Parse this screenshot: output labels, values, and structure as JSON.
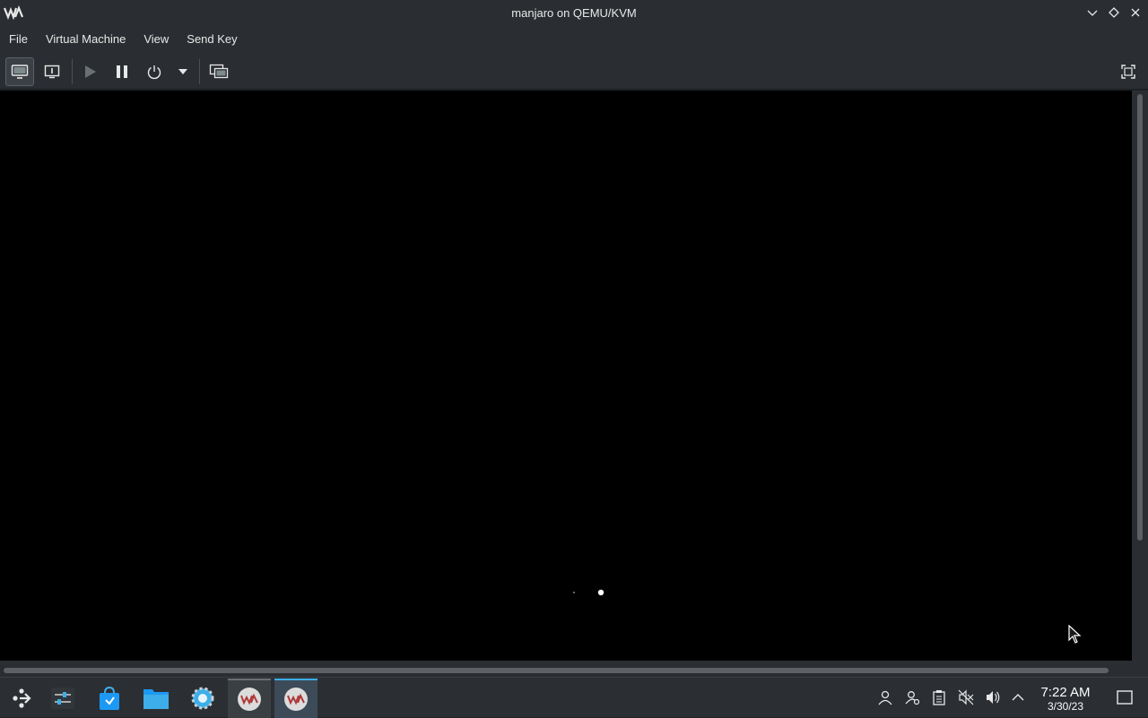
{
  "window": {
    "title": "manjaro on QEMU/KVM",
    "app_icon": "virt-manager-icon",
    "controls": [
      "minimize-icon",
      "maximize-icon",
      "close-icon"
    ]
  },
  "menu": {
    "items": [
      {
        "label": "File"
      },
      {
        "label": "Virtual Machine"
      },
      {
        "label": "View"
      },
      {
        "label": "Send Key"
      }
    ]
  },
  "toolbar": {
    "buttons": [
      "console-icon",
      "details-icon",
      "play-icon",
      "pause-icon",
      "power-icon",
      "dropdown-arrow-icon",
      "snapshots-icon",
      "fullscreen-icon"
    ],
    "selected": "console-icon"
  },
  "vm_display": {
    "background": "#000000"
  },
  "taskbar": {
    "apps": [
      "app-launcher-icon",
      "system-settings-panel-icon",
      "software-store-icon",
      "file-manager-icon",
      "settings-icon",
      "virt-manager-window-icon",
      "virt-manager-active-window-icon"
    ],
    "tray": [
      "user-icon",
      "user-switch-icon",
      "clipboard-icon",
      "mute-icon",
      "volume-icon",
      "expand-tray-icon"
    ],
    "clock": {
      "time": "7:22 AM",
      "date": "3/30/23"
    },
    "show_desktop": "show-desktop-icon"
  },
  "colors": {
    "accent": "#3daee9",
    "panel": "#2a2e32"
  }
}
